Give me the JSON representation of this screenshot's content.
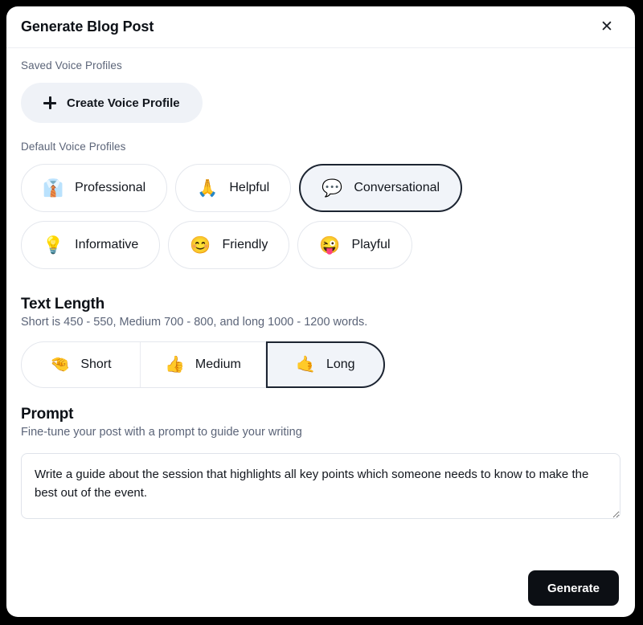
{
  "dialog": {
    "title": "Generate Blog Post",
    "close_icon": "close-icon"
  },
  "saved_voice_profiles": {
    "label": "Saved Voice Profiles",
    "create_button": {
      "label": "Create Voice Profile",
      "icon": "plus-icon"
    }
  },
  "default_voice_profiles": {
    "label": "Default Voice Profiles",
    "selected": "Conversational",
    "options": [
      {
        "label": "Professional",
        "emoji": "👔",
        "icon": "necktie-icon",
        "selected": false
      },
      {
        "label": "Helpful",
        "emoji": "🙏",
        "icon": "folded-hands-icon",
        "selected": false
      },
      {
        "label": "Conversational",
        "emoji": "💬",
        "icon": "speech-balloon-icon",
        "selected": true
      },
      {
        "label": "Informative",
        "emoji": "💡",
        "icon": "light-bulb-icon",
        "selected": false
      },
      {
        "label": "Friendly",
        "emoji": "😊",
        "icon": "smiling-face-icon",
        "selected": false
      },
      {
        "label": "Playful",
        "emoji": "😜",
        "icon": "winking-tongue-face-icon",
        "selected": false
      }
    ]
  },
  "text_length": {
    "title": "Text Length",
    "description": "Short is 450 - 550, Medium 700 - 800, and long 1000 - 1200 words.",
    "selected": "Long",
    "options": [
      {
        "label": "Short",
        "emoji": "🤏",
        "icon": "pinching-hand-icon",
        "selected": false
      },
      {
        "label": "Medium",
        "emoji": "👍",
        "icon": "thumbs-up-icon",
        "selected": false
      },
      {
        "label": "Long",
        "emoji": "🤙",
        "icon": "call-me-hand-icon",
        "selected": true
      }
    ]
  },
  "prompt": {
    "title": "Prompt",
    "description": "Fine-tune your post with a prompt to guide your writing",
    "value": "Write a guide about the session that highlights all key points which someone needs to know to make the best out of the event.",
    "placeholder": "Fine-tune your post with a prompt to guide your writing"
  },
  "footer": {
    "generate_label": "Generate"
  },
  "colors": {
    "accent_dark": "#0c0f14",
    "selected_fill": "#f1f4f9",
    "selected_border": "#1c2431",
    "muted_text": "#5b6478",
    "chip_border": "#e4e7ed"
  }
}
